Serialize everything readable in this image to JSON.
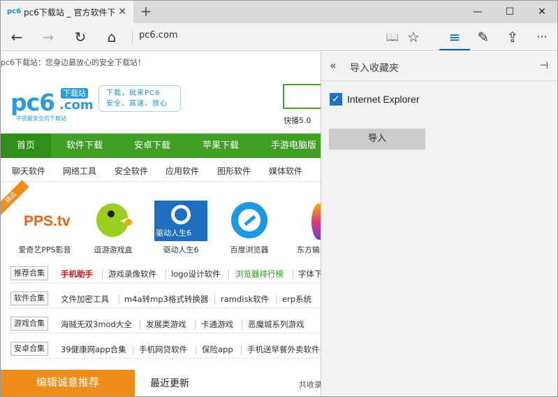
{
  "tab": {
    "icon": "pc6",
    "title": "pc6下载站 _ 官方软件下",
    "close": "✕",
    "new": "+"
  },
  "window": {
    "minimize": "—",
    "maximize": "☐",
    "close": "✕"
  },
  "nav": {
    "back": "←",
    "forward": "→",
    "refresh": "↻",
    "home": "⌂",
    "address": "pc6.com",
    "reading": "📖",
    "favorite": "☆",
    "hub": "≡",
    "notes": "✎",
    "share": "⇪",
    "more": "···"
  },
  "page": {
    "tagline": "pc6下载站：您身边最放心的安全下载站！",
    "logo": {
      "main": "pc6",
      "badge": "下载站",
      "com": ".com",
      "sub": "中国最安全的下载站"
    },
    "slogan": [
      "下载，就来PC6",
      "安全、高速、放心"
    ],
    "kuaibo": "快播5.0",
    "mainnav": [
      "首页",
      "软件下载",
      "安卓下载",
      "苹果下载",
      "手游电脑版"
    ],
    "subnav": [
      "聊天软件",
      "网络工具",
      "安全软件",
      "应用软件",
      "图形软件",
      "媒体软件"
    ],
    "ribbon": "精品",
    "apps": [
      {
        "name": "爱奇艺PPS影音",
        "img": "PPS.tv"
      },
      {
        "name": "逗游游戏盒",
        "img": ""
      },
      {
        "name": "驱动人生6",
        "img": "驱动人生6"
      },
      {
        "name": "百度浏览器",
        "img": ""
      },
      {
        "name": "东方输",
        "img": ""
      }
    ],
    "tagrows": [
      {
        "tag": "推荐合集",
        "links": [
          "手机助手",
          "游戏录像软件",
          "logo设计软件",
          "浏览器排行榜",
          "字体下"
        ]
      },
      {
        "tag": "软件合集",
        "links": [
          "文件加密工具",
          "m4a转mp3格式转换器",
          "ramdisk软件",
          "erp系统"
        ]
      },
      {
        "tag": "游戏合集",
        "links": [
          "海贼无双3mod大全",
          "发展类游戏",
          "卡通游戏",
          "恶魔城系列游戏"
        ]
      },
      {
        "tag": "安卓合集",
        "links": [
          "39健康网app合集",
          "手机网贷软件",
          "保险app",
          "手机送早餐外卖软件"
        ]
      }
    ],
    "bottom": {
      "featured": "编辑诚意推荐",
      "latest": "最近更新",
      "total": "共收录"
    }
  },
  "panel": {
    "back": "«",
    "title": "导入收藏夹",
    "pin": "⊣",
    "checkbox_label": "Internet Explorer",
    "checkbox_checked": true,
    "import_label": "导入"
  },
  "colors": {
    "accent": "#0063b1",
    "green": "#3f9f23",
    "orange": "#f08c1a",
    "checkbox": "#1a73c8"
  }
}
